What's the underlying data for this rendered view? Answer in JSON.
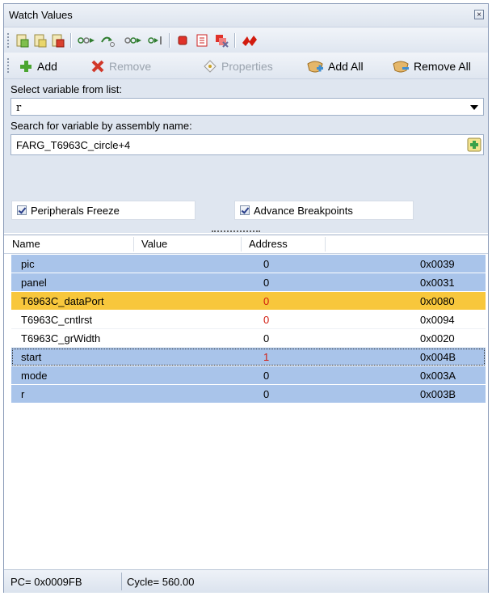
{
  "window": {
    "title": "Watch Values",
    "close_glyph": "×"
  },
  "toolbar1": {
    "icons": [
      "watch-add-icon",
      "watch-copy-icon",
      "watch-delete-icon",
      "step-over-icon",
      "step-into-icon",
      "run-to-icon",
      "step-out-icon",
      "stop-icon",
      "list-icon",
      "clear-breakpoints-icon",
      "jump-icon"
    ]
  },
  "toolbar2": {
    "add_label": "Add",
    "remove_label": "Remove",
    "properties_label": "Properties",
    "add_all_label": "Add All",
    "remove_all_label": "Remove All"
  },
  "form": {
    "select_label": "Select variable from list:",
    "select_value": "r",
    "search_label": "Search for variable by assembly name:",
    "search_value": "FARG_T6963C_circle+4",
    "peripherals_freeze_label": "Peripherals Freeze",
    "advance_breakpoints_label": "Advance Breakpoints"
  },
  "table": {
    "columns": [
      "Name",
      "Value",
      "Address"
    ],
    "rows": [
      {
        "name": "pic",
        "value": "0",
        "address": "0x0039"
      },
      {
        "name": "panel",
        "value": "0",
        "address": "0x0031"
      },
      {
        "name": "T6963C_dataPort",
        "value": "0",
        "address": "0x0080"
      },
      {
        "name": "T6963C_cntlrst",
        "value": "0",
        "address": "0x0094"
      },
      {
        "name": "T6963C_grWidth",
        "value": "0",
        "address": "0x0020"
      },
      {
        "name": "start",
        "value": "1",
        "address": "0x004B"
      },
      {
        "name": "mode",
        "value": "0",
        "address": "0x003A"
      },
      {
        "name": "r",
        "value": "0",
        "address": "0x003B"
      }
    ]
  },
  "status": {
    "pc": "PC= 0x0009FB",
    "cycle": "Cycle= 560.00"
  },
  "colors": {
    "selected_row": "#a9c4ea",
    "highlight_row": "#f8c73c",
    "changed_value": "#d21b0e"
  }
}
